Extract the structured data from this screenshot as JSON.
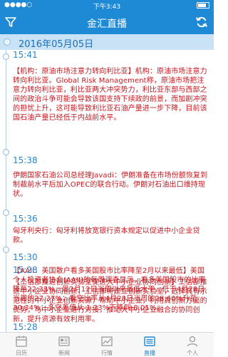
{
  "status_bar": {
    "carrier": "",
    "time": "下午3:43"
  },
  "nav": {
    "title": "金汇直播"
  },
  "date_header": {
    "date": "2016年05月05日"
  },
  "feed": [
    {
      "time": "15:41",
      "red": false,
      "text": "【机构：原油市场注意力转向利比亚】机构：原油市场注意力转向利比亚。Global Risk Management称，原油市场把注意力转向利比亚，利比亚两大冲突势力，利比亚东部与西部之间的政治斗争可能会导致该国支持下续政的前景，而加剧冲突的担忧上升，这可能导致利比亚石油产量进一步下降，目前该国石油产量已经低于内战前水平。"
    },
    {
      "time": "15:38",
      "red": false,
      "text": "伊朗国家石油公司总经理Javadi：伊朗准备在市场份额恢复到制裁前水平后加入OPEC的联合行动。伊朗对石油出口维持现状。"
    },
    {
      "time": "15:36",
      "red": false,
      "text": "匈牙利央行：匈牙利将放宽银行资本规定以促进中小企业贷款。"
    },
    {
      "time": "15:30",
      "red": true,
      "text": "【AAII：美国散户看多美国股市比率降至2月以来最低】美国个人投资者协会(AAII)的每周调查显示，看多美国股市的比率降至22.33%，是2月12日当周以来最低水平，低于4月28日当周的27.37%；看空比率从4月28日当周的28.60%升至30.34%；多空差值从-1.23%下降到-8.01%。"
    },
    {
      "time": "15:28",
      "red": false,
      "text": "【工信部推进创新实验室促进大中小企业协同创新】工信部推进中小企业协同创新，工信部将建立创新实验室，选择具有示范性的中小企业创新资源，帮助中小企业，利用其创新方面的优势，与中小企业进行对接，推动大中小企业融合的协同创新，提升资源有效利用率。"
    },
    {
      "time": "15:28",
      "red": false,
      "text": ""
    }
  ],
  "tabs": [
    {
      "label": "日历",
      "icon": "calendar-icon"
    },
    {
      "label": "新闻",
      "icon": "news-icon"
    },
    {
      "label": "行情",
      "icon": "chart-icon"
    },
    {
      "label": "直播",
      "icon": "live-icon",
      "active": true
    },
    {
      "label": "个人",
      "icon": "person-icon"
    }
  ],
  "colors": {
    "brand": "#1e8ad6",
    "date_bg": "#c9e2f6",
    "time": "#2a85cf",
    "alert_red": "#c4171e"
  }
}
